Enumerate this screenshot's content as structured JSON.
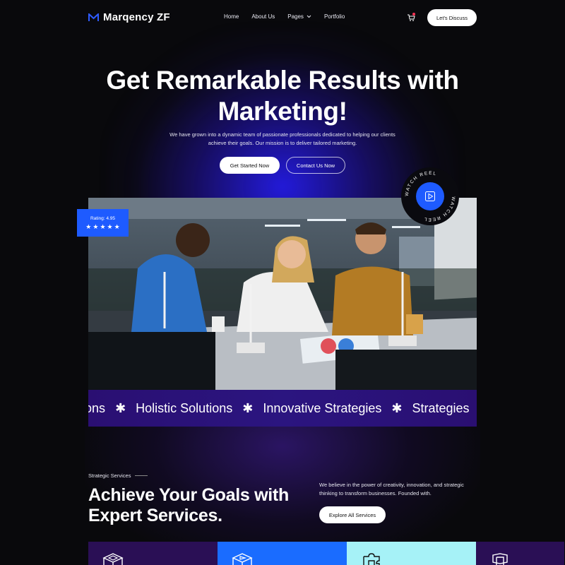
{
  "brand": {
    "name": "Marqency ZF"
  },
  "nav": {
    "items": [
      {
        "label": "Home"
      },
      {
        "label": "About Us"
      },
      {
        "label": "Pages",
        "has_dropdown": true
      },
      {
        "label": "Portfolio"
      }
    ],
    "cta": "Let's Discuss"
  },
  "hero": {
    "title": "Get Remarkable Results with Marketing!",
    "subtitle": "We have grown into a dynamic team of passionate professionals dedicated to helping our clients achieve their goals. Our mission is to deliver tailored marketing.",
    "primary_button": "Get Started Now",
    "secondary_button": "Contact Us Now"
  },
  "rating": {
    "label": "Rating: 4.95",
    "stars": 5
  },
  "reel": {
    "label": "WATCH REEL"
  },
  "marquee": {
    "items": [
      "Solutions",
      "Holistic Solutions",
      "Innovative Strategies",
      "Strategies"
    ]
  },
  "services": {
    "eyebrow": "Strategic Services",
    "title": "Achieve Your Goals with Expert Services.",
    "description": "We believe in the power of creativity, innovation, and strategic thinking to transform businesses. Founded with.",
    "button": "Explore All Services"
  },
  "cards": [
    {
      "icon": "cube-icon",
      "color": "#2a0f55"
    },
    {
      "icon": "cube-play-icon",
      "color": "#1a6cff"
    },
    {
      "icon": "puzzle-icon",
      "color": "#a6f2f7"
    },
    {
      "icon": "layers-icon",
      "color": "#2a0f55"
    }
  ],
  "colors": {
    "accent": "#1e5bff",
    "background": "#09090c",
    "marquee": "#2b1580"
  }
}
